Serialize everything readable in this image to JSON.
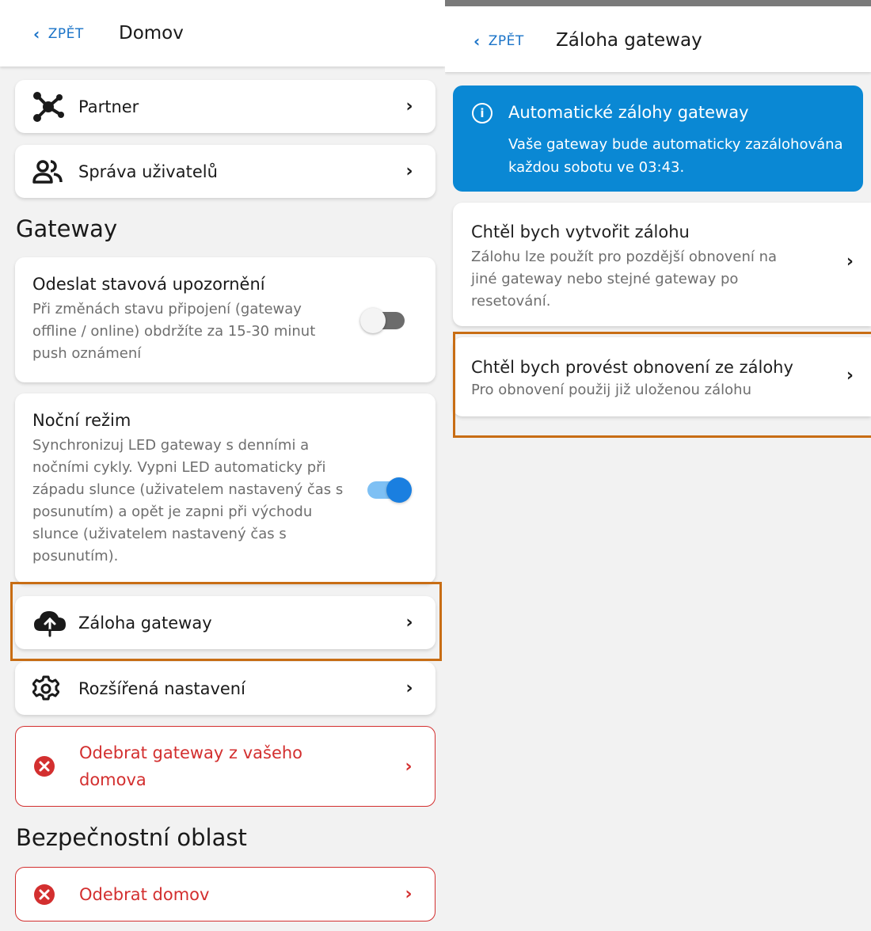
{
  "left_screen": {
    "back_label": "ZPĚT",
    "title": "Domov",
    "items": [
      {
        "label": "Partner",
        "icon": "partner-network-icon"
      },
      {
        "label": "Správa uživatelů",
        "icon": "users-icon"
      }
    ],
    "gateway_section": {
      "heading": "Gateway",
      "status_notifications": {
        "title": "Odeslat stavová upozornění",
        "description": "Při změnách stavu připojení (gateway offline / online) obdržíte za 15-30 minut push oznámení",
        "enabled": false
      },
      "night_mode": {
        "title": "Noční režim",
        "description": "Synchronizuj LED gateway s denními a nočními cykly. Vypni LED automaticky při západu slunce (uživatelem nastavený čas s posunutím) a opět je zapni při východu slunce (uživatelem nastavený čas s posunutím).",
        "enabled": true
      },
      "backup": {
        "label": "Záloha gateway",
        "icon": "cloud-upload-icon"
      },
      "advanced": {
        "label": "Rozšířená nastavení",
        "icon": "gear-icon"
      },
      "remove_gateway": {
        "label": "Odebrat gateway z vašeho domova",
        "icon": "error-circle-icon"
      }
    },
    "security_section": {
      "heading": "Bezpečnostní oblast",
      "remove_home": {
        "label": "Odebrat domov",
        "icon": "error-circle-icon"
      }
    }
  },
  "right_screen": {
    "back_label": "ZPĚT",
    "title": "Záloha gateway",
    "banner": {
      "title": "Automatické zálohy gateway",
      "text": "Vaše gateway bude automaticky zazálohována každou sobotu ve 03:43.",
      "icon": "info-icon",
      "info_glyph": "i"
    },
    "create_backup": {
      "title": "Chtěl bych vytvořit zálohu",
      "description": "Zálohu lze použít pro pozdější obnovení na jiné gateway nebo stejné gateway po resetování."
    },
    "restore_backup": {
      "title": "Chtěl bych provést obnovení ze zálohy",
      "description": "Pro obnovení použij již uloženou zálohu"
    }
  },
  "glyphs": {
    "back": "‹",
    "chevron": "›"
  },
  "colors": {
    "accent": "#1a73c8",
    "banner": "#0a88d4",
    "danger": "#d32f2f",
    "highlight": "#c86d14",
    "toggle_on": "#1a7fe0"
  }
}
